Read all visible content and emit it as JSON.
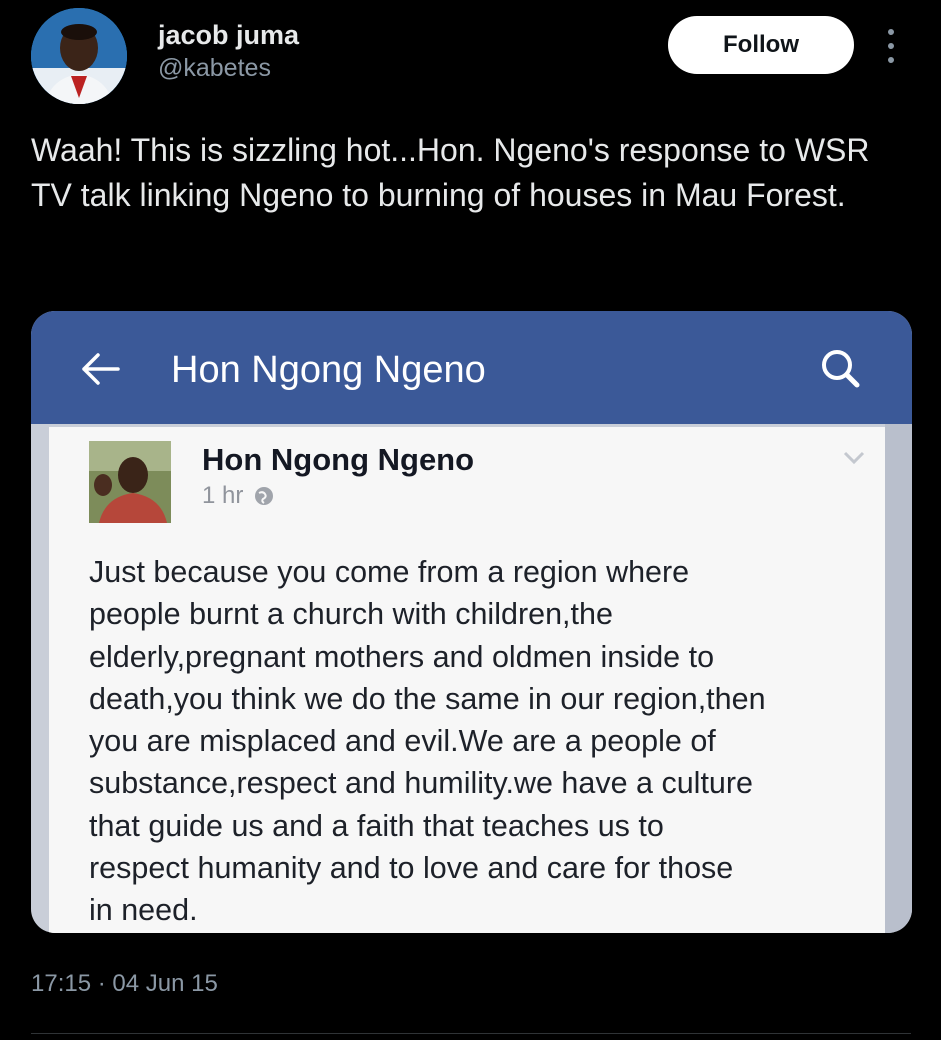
{
  "author": {
    "name": "jacob juma",
    "handle": "@kabetes"
  },
  "actions": {
    "follow_label": "Follow"
  },
  "tweet": {
    "text": "Waah! This is sizzling hot...Hon. Ngeno's response to WSR TV talk linking Ngeno to burning of houses in Mau Forest.",
    "timestamp": "17:15 · 04 Jun 15"
  },
  "embedded_screenshot": {
    "app_bar_title": "Hon Ngong Ngeno",
    "app_bar_color": "#3b5998",
    "post": {
      "author": "Hon Ngong Ngeno",
      "time": "1 hr",
      "body_lines": [
        "Just because you come from a region where",
        "people burnt a church with children,the",
        "elderly,pregnant mothers and oldmen inside to",
        "death,you think we do the same in our region,then",
        "you are misplaced and evil.We are a people of",
        "substance,respect and humility.we have a culture",
        "that guide us and a faith that teaches us to",
        "respect humanity and to love and care for those",
        "in need."
      ]
    },
    "icons": [
      "back-arrow-icon",
      "search-icon",
      "globe-icon",
      "chevron-down-icon"
    ]
  },
  "icons": [
    "more-options-icon"
  ]
}
